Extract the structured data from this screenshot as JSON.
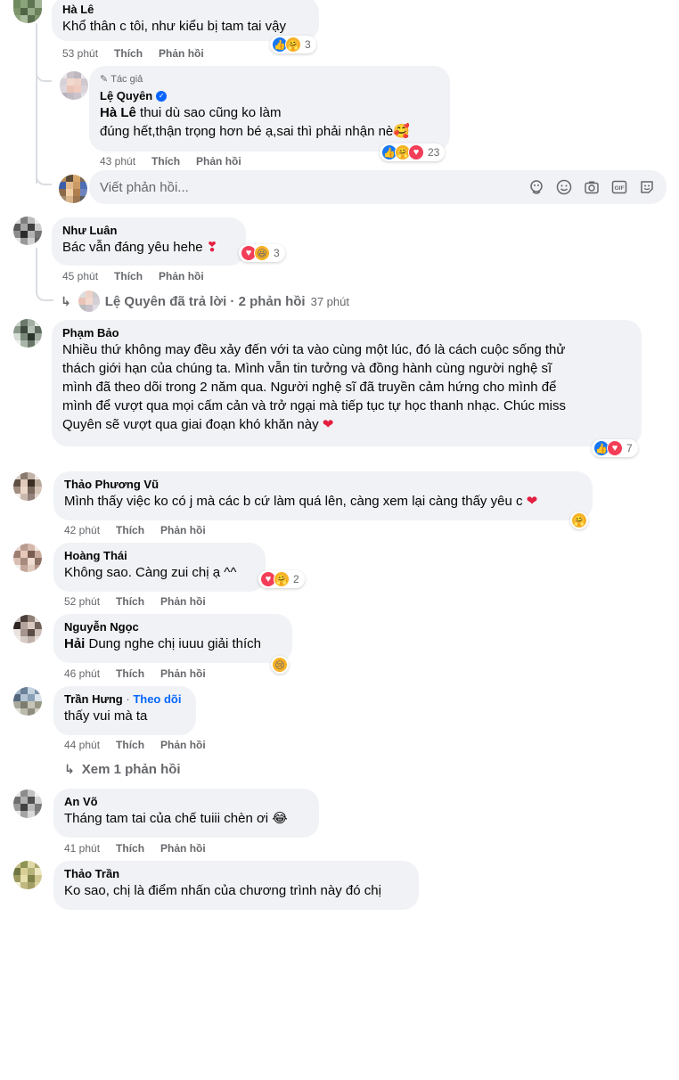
{
  "comments": [
    {
      "name": "Hà Lê",
      "text": "Khổ thân c tôi, như kiểu bị tam tai vậy",
      "time": "53 phút",
      "like": "Thích",
      "reply": "Phản hồi",
      "reaction_count": "3",
      "reactions": [
        "like-icon",
        "care-icon"
      ]
    },
    {
      "badge": "Tác giả",
      "name": "Lệ Quyên",
      "verified": true,
      "mention": "Hà Lê",
      "text_line1": " thui dù sao cũng ko làm",
      "text_line2": "đúng hết,thận trọng hơn bé ạ,sai thì phải nhận nè🥰",
      "time": "43 phút",
      "like": "Thích",
      "reply": "Phản hồi",
      "reaction_count": "23",
      "reactions": [
        "like-icon",
        "care-icon",
        "love-icon"
      ]
    },
    {
      "name": "Như Luân",
      "text": "Bác vẫn đáng yêu hehe",
      "time": "45 phút",
      "like": "Thích",
      "reply": "Phản hồi",
      "reaction_count": "3",
      "reactions": [
        "love-icon",
        "haha-icon"
      ]
    },
    {
      "name": "Phạm Bảo",
      "lines": [
        "Nhiều thứ không may đều xảy đến với ta vào cùng một lúc, đó là cách cuộc sống thử",
        "thách giới hạn của chúng ta. Mình vẫn tin tưởng và đồng hành cùng người nghệ sĩ",
        "mình đã theo dõi trong 2 năm qua. Người nghệ sĩ đã truyền cảm hứng cho mình để",
        "mình để vượt qua mọi cấm cản và trở ngại mà tiếp tục tự học thanh nhạc. Chúc miss",
        "Quyên sẽ vượt qua giai đoạn khó khăn này"
      ],
      "reaction_count": "7",
      "reactions": [
        "like-icon",
        "love-icon"
      ]
    },
    {
      "name": "Thảo Phương Vũ",
      "text": "Mình thấy việc ko có j mà các b cứ làm quá lên, càng xem lại càng thấy yêu c",
      "time": "42 phút",
      "like": "Thích",
      "reply": "Phản hồi",
      "reactions": [
        "care-icon"
      ]
    },
    {
      "name": "Hoàng Thái",
      "text": "Không sao. Càng zui chị ạ ^^",
      "time": "52 phút",
      "like": "Thích",
      "reply": "Phản hồi",
      "reaction_count": "2",
      "reactions": [
        "love-icon",
        "care-icon"
      ]
    },
    {
      "name": "Nguyễn Ngọc",
      "mention": "Hải",
      "text": " Dung nghe chị iuuu giải thích",
      "time": "46 phút",
      "like": "Thích",
      "reply": "Phản hồi",
      "reactions": [
        "sad-icon"
      ]
    },
    {
      "name": "Trần Hưng",
      "dot": " · ",
      "follow": "Theo dõi",
      "text": "thấy vui mà ta",
      "time": "44 phút",
      "like": "Thích",
      "reply": "Phản hồi"
    },
    {
      "name": "An Võ",
      "text": "Tháng tam tai của chế tuiii chèn ơi 😂",
      "time": "41 phút",
      "like": "Thích",
      "reply": "Phản hồi"
    },
    {
      "name": "Thảo Trần",
      "text": "Ko sao, chị là điểm nhấn của chương trình này đó chị"
    }
  ],
  "reply_input": {
    "placeholder": "Viết phản hồi..."
  },
  "replies_summary": {
    "text": "Lệ Quyên đã trả lời · 2 phản hồi",
    "time": "37 phút"
  },
  "see_more": {
    "text": "Xem 1 phản hồi"
  },
  "colors": {
    "bubble": "#f0f2f5",
    "meta": "#65676b",
    "link": "#0866ff",
    "heart": "#e41e3f",
    "verified": "#0866ff"
  }
}
